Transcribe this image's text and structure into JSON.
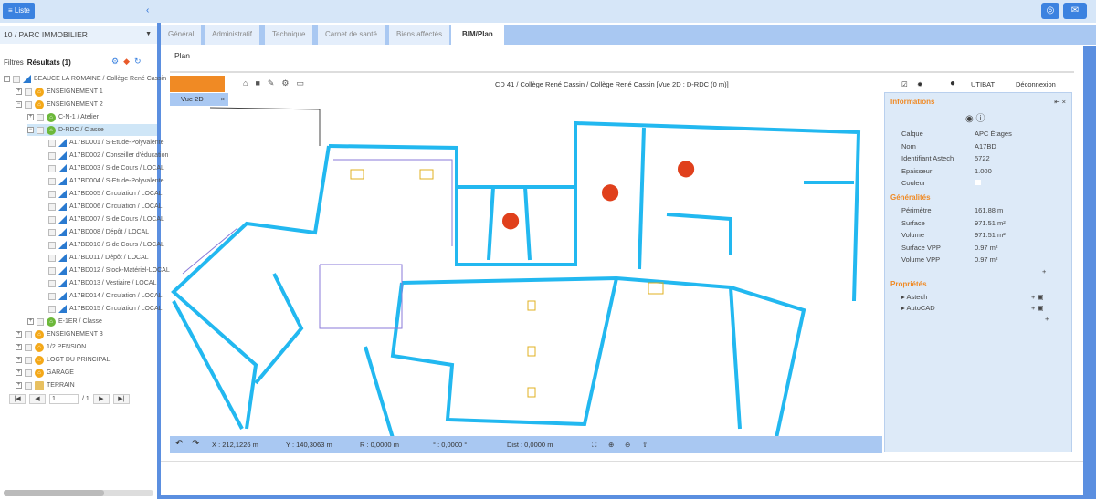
{
  "topbar": {
    "liste_label": "≡ Liste",
    "collapse": "‹"
  },
  "left": {
    "scope": "10 / PARC IMMOBILIER",
    "filters": "Filtres",
    "results": "Résultats (1)",
    "tree": [
      {
        "label": "BEAUCE LA ROMAINE / Collège René Cassin",
        "level": 0,
        "icon": "site"
      },
      {
        "label": "ENSEIGNEMENT 1",
        "level": 1,
        "icon": "building"
      },
      {
        "label": "ENSEIGNEMENT 2",
        "level": 1,
        "icon": "building"
      },
      {
        "label": "C-N-1 / Atelier",
        "level": 2,
        "icon": "floor"
      },
      {
        "label": "D-RDC / Classe",
        "level": 2,
        "icon": "floor",
        "selected": true
      },
      {
        "label": "A17BD001 / S-Etude-Polyvalente",
        "level": 3,
        "icon": "room"
      },
      {
        "label": "A17BD002 / Conseiller d'éducation",
        "level": 3,
        "icon": "room"
      },
      {
        "label": "A17BD003 / S-de Cours / LOCAL",
        "level": 3,
        "icon": "room"
      },
      {
        "label": "A17BD004 / S-Etude-Polyvalente",
        "level": 3,
        "icon": "room"
      },
      {
        "label": "A17BD005 / Circulation / LOCAL",
        "level": 3,
        "icon": "room"
      },
      {
        "label": "A17BD006 / Circulation / LOCAL",
        "level": 3,
        "icon": "room"
      },
      {
        "label": "A17BD007 / S-de Cours / LOCAL",
        "level": 3,
        "icon": "room"
      },
      {
        "label": "A17BD008 / Dépôt / LOCAL",
        "level": 3,
        "icon": "room"
      },
      {
        "label": "A17BD010 / S-de Cours / LOCAL",
        "level": 3,
        "icon": "room"
      },
      {
        "label": "A17BD011 / Dépôt / LOCAL",
        "level": 3,
        "icon": "room"
      },
      {
        "label": "A17BD012 / Stock-Matériel-LOCAL",
        "level": 3,
        "icon": "room"
      },
      {
        "label": "A17BD013 / Vestiaire / LOCAL",
        "level": 3,
        "icon": "room"
      },
      {
        "label": "A17BD014 / Circulation / LOCAL",
        "level": 3,
        "icon": "room"
      },
      {
        "label": "A17BD015 / Circulation / LOCAL",
        "level": 3,
        "icon": "room"
      },
      {
        "label": "E-1ER / Classe",
        "level": 2,
        "icon": "floor"
      },
      {
        "label": "ENSEIGNEMENT 3",
        "level": 1,
        "icon": "building"
      },
      {
        "label": "1/2 PENSION",
        "level": 1,
        "icon": "building"
      },
      {
        "label": "LOGT DU PRINCIPAL",
        "level": 1,
        "icon": "building"
      },
      {
        "label": "GARAGE",
        "level": 1,
        "icon": "building"
      },
      {
        "label": "TERRAIN",
        "level": 1,
        "icon": "land"
      }
    ],
    "pager": {
      "page": "1",
      "total": "/ 1"
    }
  },
  "tabs": [
    "Général",
    "Administratif",
    "Technique",
    "Carnet de santé",
    "Biens affectés",
    "BIM/Plan"
  ],
  "active_tab": "BIM/Plan",
  "plan_label": "Plan",
  "viewer": {
    "breadcrumb": {
      "a": "CD 41",
      "b": "Collège René Cassin",
      "rest": " / Collège René Cassin [Vue 2D : D-RDC (0 m)]"
    },
    "view_tab": "Vue 2D",
    "user": "UTIBAT",
    "logout": "Déconnexion"
  },
  "panel": {
    "informations": "Informations",
    "info_rows": [
      [
        "Calque",
        "APC Étages"
      ],
      [
        "Nom",
        "A17BD"
      ],
      [
        "Identifiant Astech",
        "5722"
      ],
      [
        "Epaisseur",
        "1.000"
      ],
      [
        "Couleur",
        ""
      ]
    ],
    "generalites": "Généralités",
    "gen_rows": [
      [
        "Périmètre",
        "161.88 m"
      ],
      [
        "Surface",
        "971.51 m²"
      ],
      [
        "Volume",
        "971.51 m²"
      ],
      [
        "Surface VPP",
        "0.97 m²"
      ],
      [
        "Volume VPP",
        "0.97 m²"
      ]
    ],
    "proprietes": "Propriétés",
    "props": [
      "Astech",
      "AutoCAD"
    ]
  },
  "status": {
    "x": "X : 212,1226 m",
    "y": "Y : 140,3063 m",
    "r": "R : 0,0000 m",
    "angle": "° : 0,0000 °",
    "dist": "Dist : 0,0000 m"
  },
  "colors": {
    "accent": "#3b82e0",
    "orange": "#f08a24",
    "wall": "#22b8f0"
  }
}
